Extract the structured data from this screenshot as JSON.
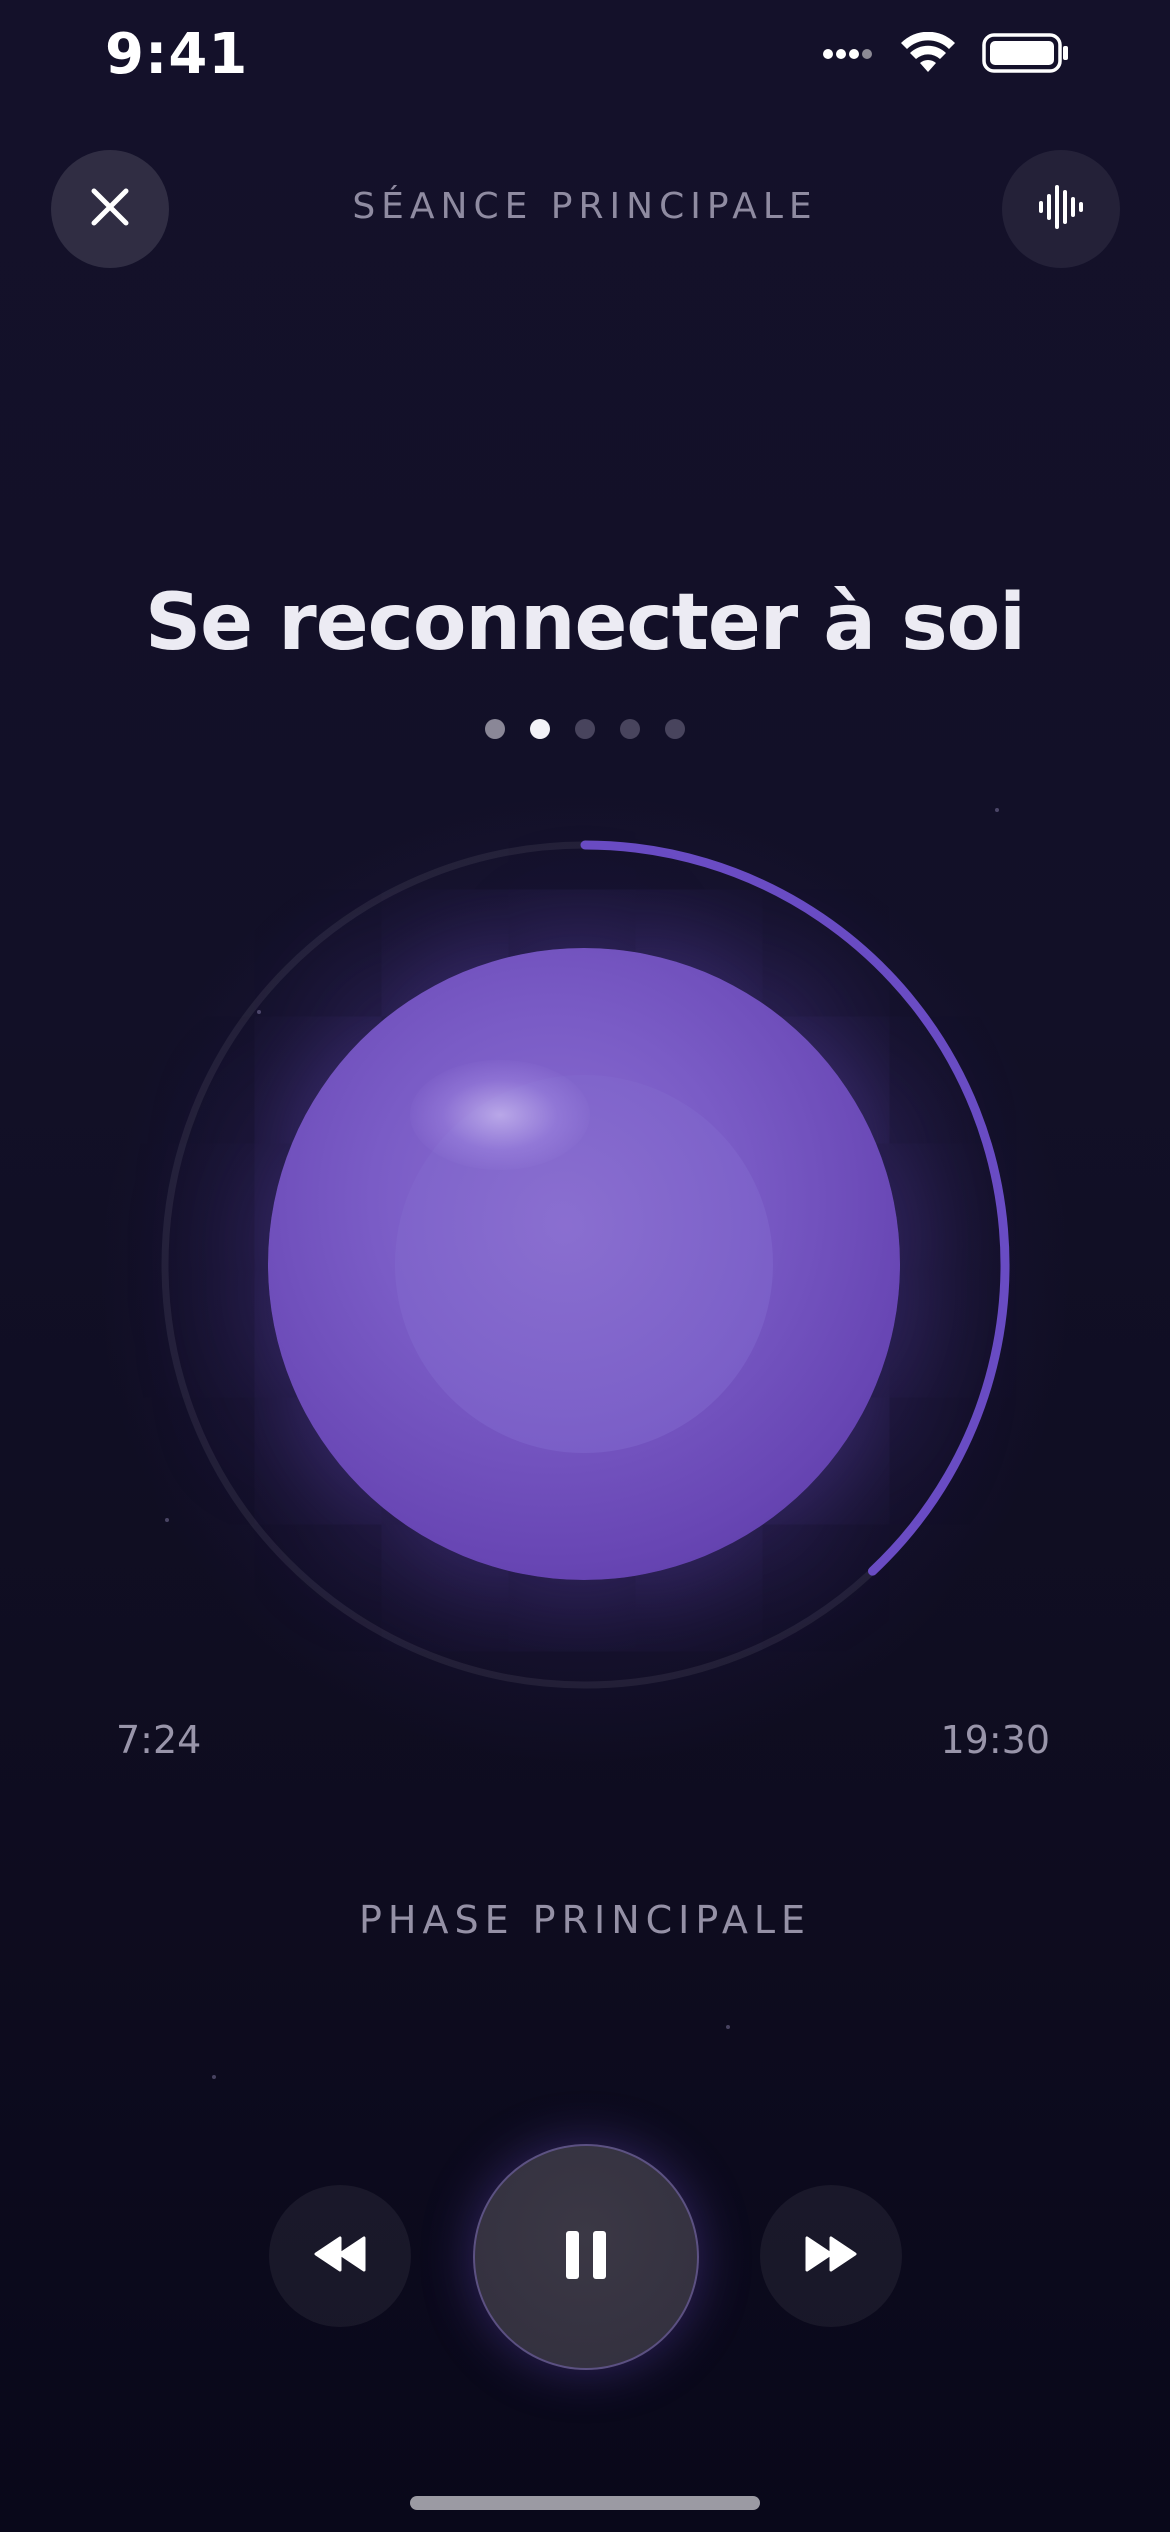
{
  "status_bar": {
    "time": "9:41"
  },
  "header": {
    "title": "SÉANCE PRINCIPALE",
    "close_icon": "close-icon",
    "audio_icon": "sound-wave-icon"
  },
  "session": {
    "title": "Se reconnecter à soi",
    "step_indicator": {
      "total": 5,
      "current": 2
    },
    "progress_fraction": 0.38,
    "elapsed": "7:24",
    "total": "19:30",
    "phase": "PHASE PRINCIPALE"
  },
  "controls": {
    "rewind_icon": "rewind-icon",
    "pause_icon": "pause-icon",
    "forward_icon": "fast-forward-icon"
  },
  "colors": {
    "background": "#121027",
    "accent": "#6a4cc4",
    "orb": "#7a5cc6",
    "text_muted": "#8f8ba1"
  }
}
